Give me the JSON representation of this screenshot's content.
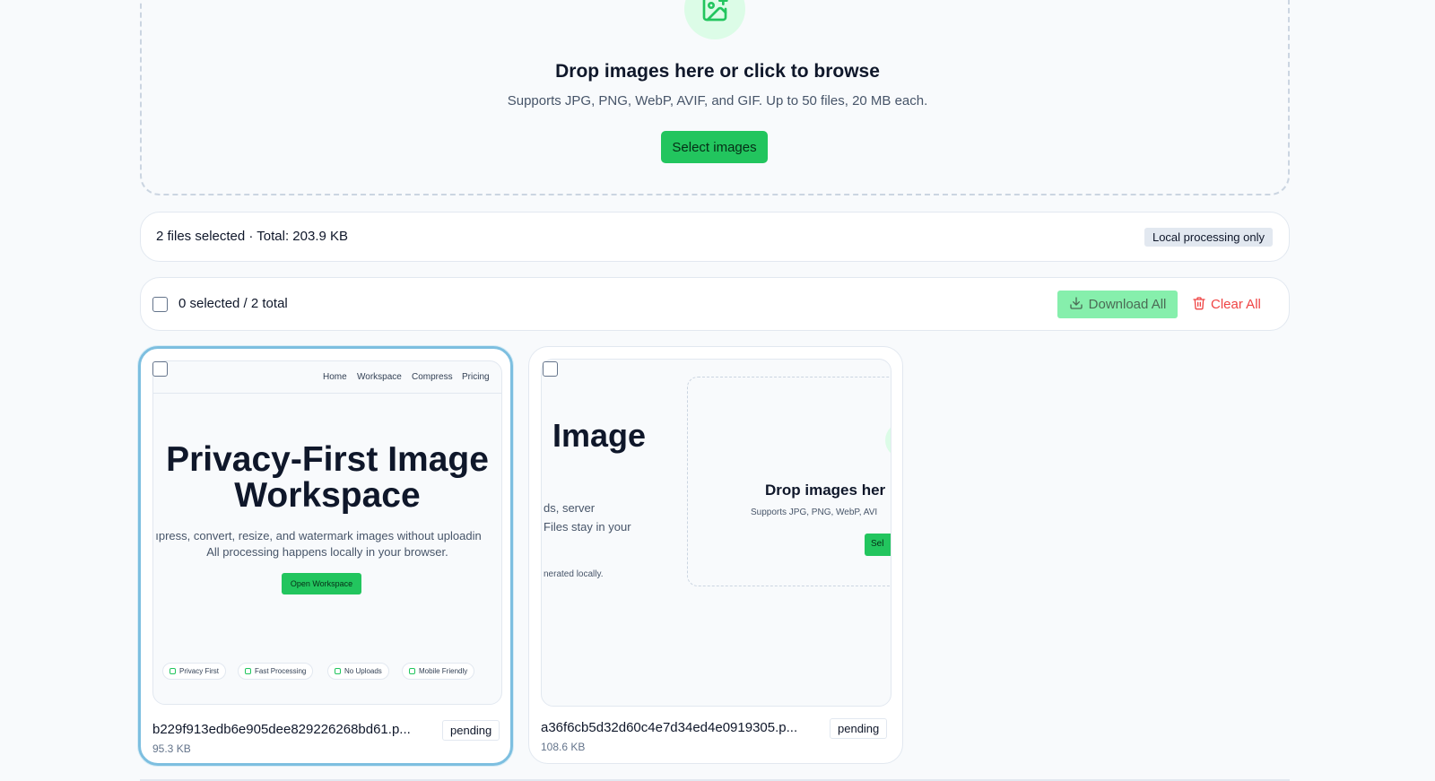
{
  "dropzone": {
    "icon": "image-plus-icon",
    "title": "Drop images here or click to browse",
    "subtitle": "Supports JPG, PNG, WebP, AVIF, and GIF. Up to 50 files, 20 MB each.",
    "button_label": "Select images"
  },
  "summary": {
    "text": "2 files selected · Total: 203.9 KB",
    "badge": "Local processing only"
  },
  "toolbar": {
    "count_text": "0 selected / 2 total",
    "download_all_label": "Download All",
    "clear_all_label": "Clear All",
    "download_icon": "download-icon",
    "clear_icon": "trash-icon"
  },
  "files": [
    {
      "name": "b229f913edb6e905dee829226268bd61.p...",
      "size": "95.3 KB",
      "status": "pending",
      "selected_highlight": true,
      "preview": {
        "nav": [
          "Home",
          "Workspace",
          "Compress",
          "Pricing"
        ],
        "heading_line1": "Privacy-First Image",
        "heading_line2": "Workspace",
        "para_line1": "ıpress, convert, resize, and watermark images without uploadin",
        "para_line2": "All processing happens locally in your browser.",
        "button": "Open Workspace",
        "pills": [
          "Privacy First",
          "Fast Processing",
          "No Uploads",
          "Mobile Friendly"
        ]
      }
    },
    {
      "name": "a36f6cb5d32d60c4e7d34ed4e0919305.p...",
      "size": "108.6 KB",
      "status": "pending",
      "selected_highlight": false,
      "preview": {
        "heading": "l Image",
        "line1": "ds, server",
        "line2": "Files stay in your",
        "small": "nerated locally.",
        "drop_title": "Drop images her",
        "drop_sub": "Supports JPG, PNG, WebP, AVI",
        "button": "Sel"
      }
    }
  ],
  "colors": {
    "accent": "#22c55e",
    "accent_light": "#dcfce7",
    "danger": "#ef4444",
    "selected_border": "#7dbfe0"
  }
}
